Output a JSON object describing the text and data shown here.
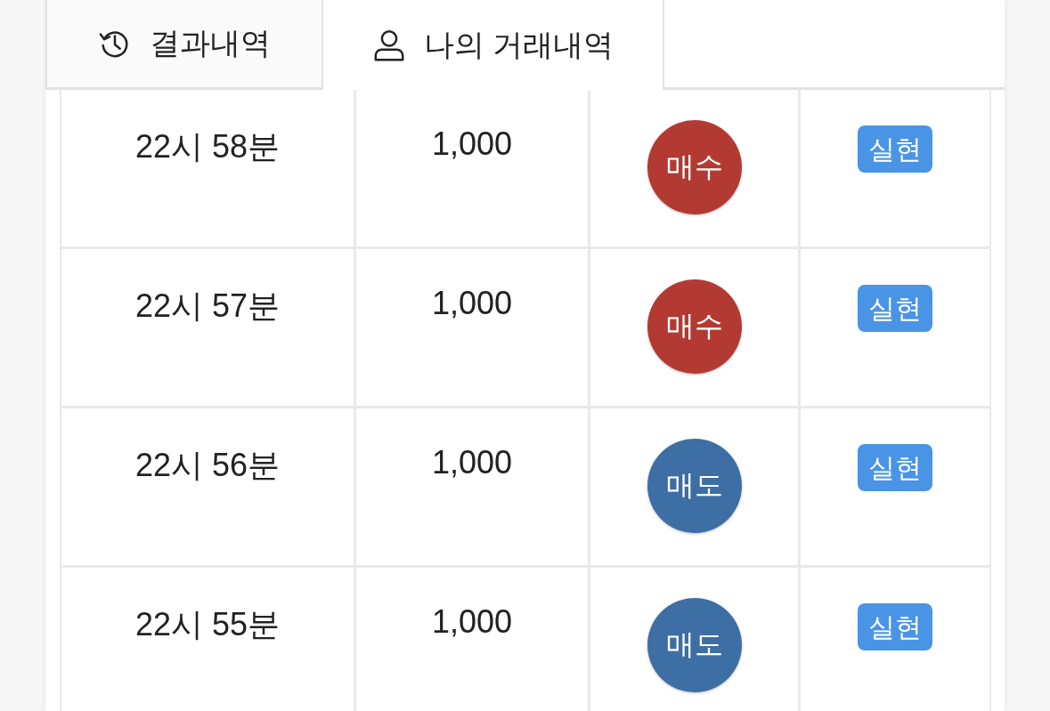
{
  "tabs": [
    {
      "kind": "results",
      "label": "결과내역",
      "selected": false
    },
    {
      "kind": "personal",
      "label": "나의 거래내역",
      "selected": true
    }
  ],
  "rows": [
    {
      "time": "22시 58분",
      "amount": "1,000",
      "side": {
        "kind": "buy",
        "label": "매수"
      },
      "status": "실현"
    },
    {
      "time": "22시 57분",
      "amount": "1,000",
      "side": {
        "kind": "buy",
        "label": "매수"
      },
      "status": "실현"
    },
    {
      "time": "22시 56분",
      "amount": "1,000",
      "side": {
        "kind": "sell",
        "label": "매도"
      },
      "status": "실현"
    },
    {
      "time": "22시 55분",
      "amount": "1,000",
      "side": {
        "kind": "sell",
        "label": "매도"
      },
      "status": "실현"
    }
  ]
}
